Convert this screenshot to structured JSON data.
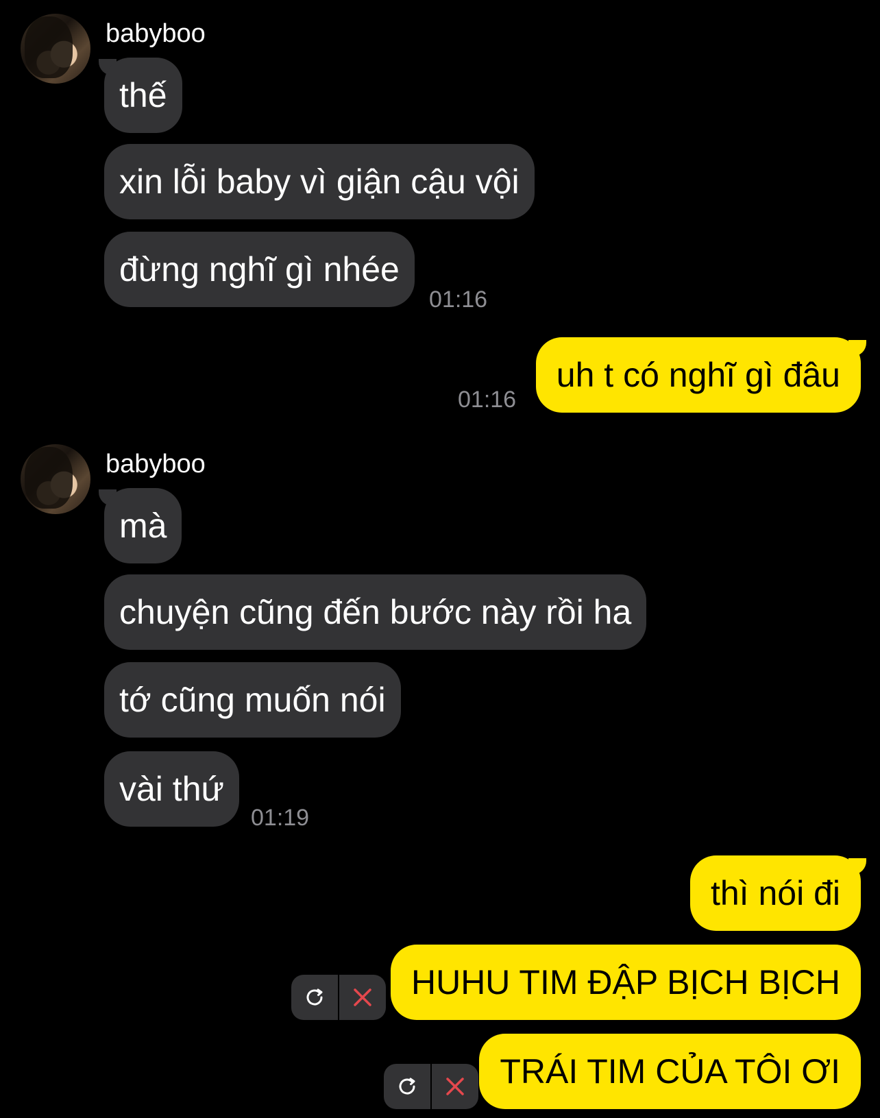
{
  "contact": {
    "name": "babyboo"
  },
  "groups": [
    {
      "sender": "babyboo",
      "messages": [
        "thế",
        "xin lỗi baby vì giận cậu vội",
        "đừng nghĩ gì nhée"
      ],
      "time": "01:16"
    },
    {
      "sender": "me",
      "messages": [
        "uh t có nghĩ gì đâu"
      ],
      "time": "01:16"
    },
    {
      "sender": "babyboo",
      "messages": [
        "mà",
        "chuyện cũng đến bước này rồi ha",
        "tớ cũng muốn nói",
        "vài thứ"
      ],
      "time": "01:19"
    },
    {
      "sender": "me",
      "messages": [
        "thì nói đi",
        "HUHU TIM ĐẬP BỊCH BỊCH",
        "TRÁI TIM CỦA TÔI ƠI"
      ]
    }
  ],
  "failed_message_actions": {
    "retry_icon": "retry-icon",
    "delete_icon": "close-icon",
    "delete_color": "#e5484d"
  },
  "colors": {
    "incoming": "#333335",
    "outgoing": "#ffe500",
    "background": "#000000",
    "timestamp": "#8e8e93"
  }
}
